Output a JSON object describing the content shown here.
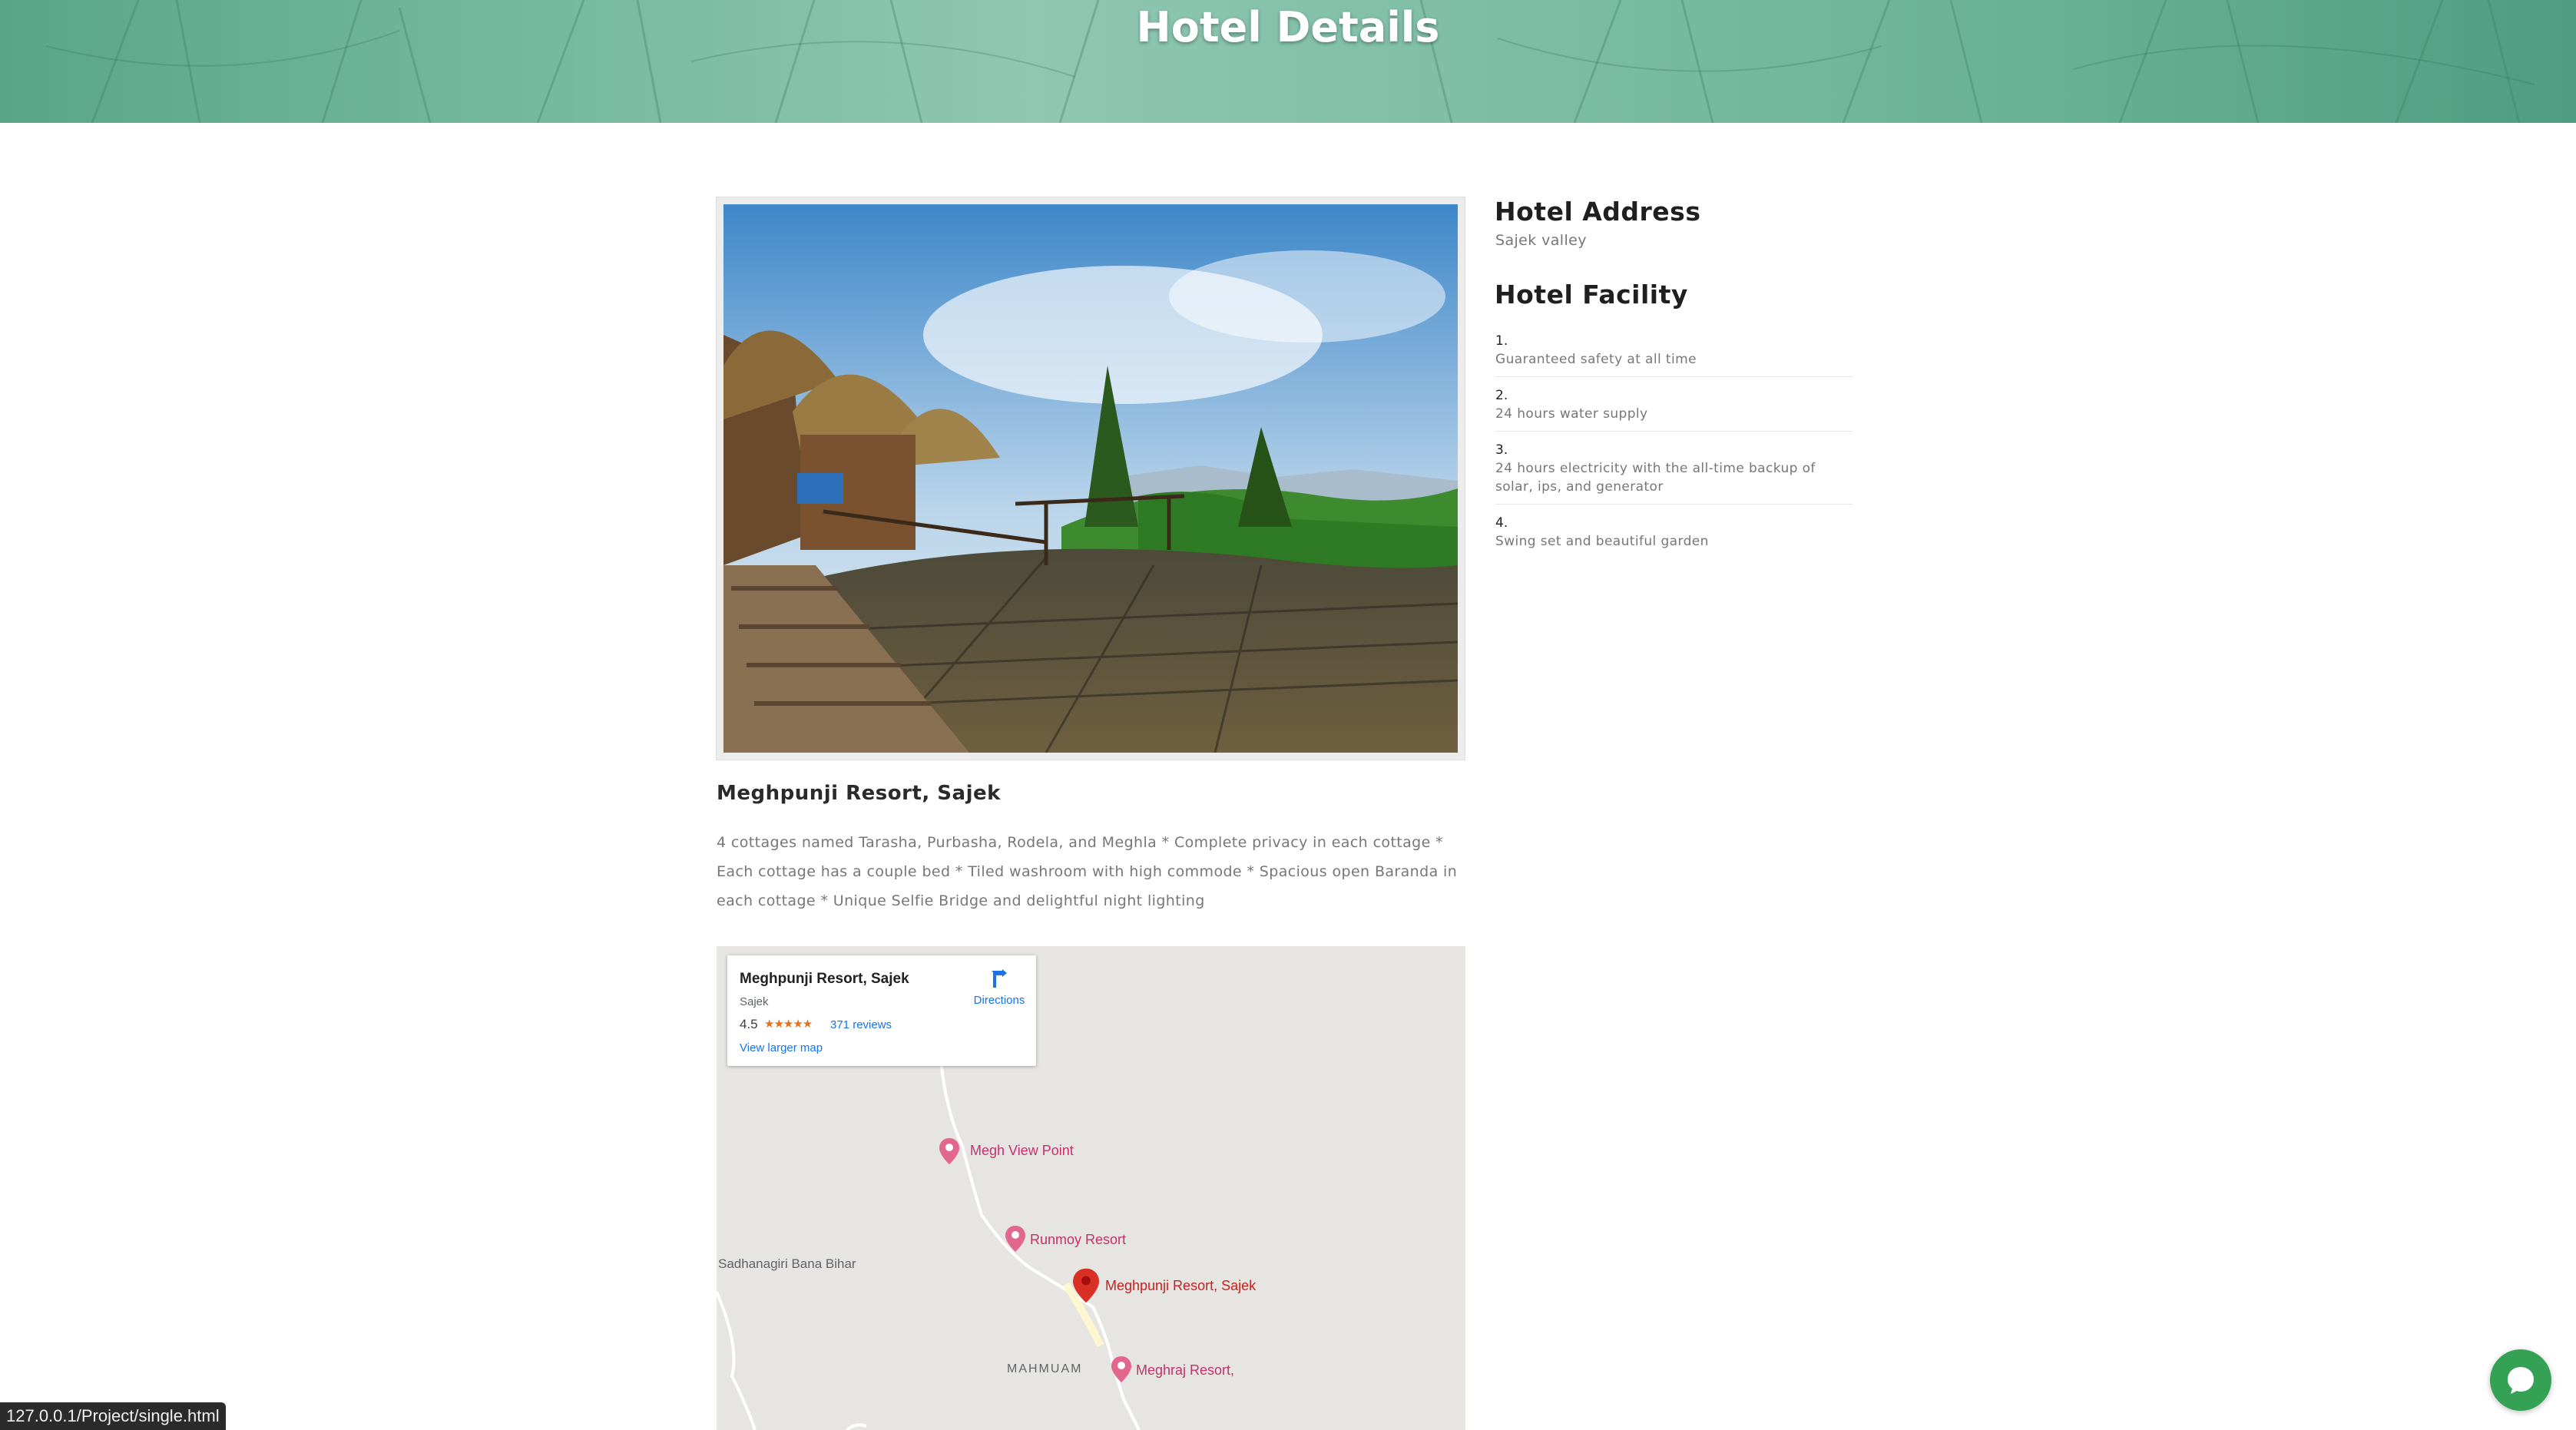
{
  "hero": {
    "title": "Hotel Details"
  },
  "hotel": {
    "photo_alt": "Meghpunji Resort cottages with wooden deck overlooking green hills",
    "name": "Meghpunji Resort, Sajek",
    "description": "4 cottages named Tarasha, Purbasha, Rodela, and Meghla * Complete privacy in each cottage * Each cottage has a couple bed * Tiled washroom with high commode * Spacious open Baranda in each cottage * Unique Selfie Bridge and delightful night lighting"
  },
  "address": {
    "heading": "Hotel Address",
    "value": "Sajek valley"
  },
  "facility": {
    "heading": "Hotel Facility",
    "items": [
      {
        "num": "1.",
        "text": "Guaranteed safety at all time"
      },
      {
        "num": "2.",
        "text": "24 hours water supply"
      },
      {
        "num": "3.",
        "text": "24 hours electricity with the all-time backup of solar, ips, and generator"
      },
      {
        "num": "4.",
        "text": "Swing set and beautiful garden"
      }
    ]
  },
  "map": {
    "card": {
      "title": "Meghpunji Resort, Sajek",
      "subtitle": "Sajek",
      "rating": "4.5",
      "stars": "★★★★★",
      "reviews": "371 reviews",
      "larger_map": "View larger map",
      "directions": "Directions"
    },
    "pois": {
      "megh_view": "Megh View Point",
      "runmoy": "Runmoy Resort",
      "meghpunji": "Meghpunji Resort, Sajek",
      "meghraj": "Meghraj Resort,",
      "sadhanagiri": "Sadhanagiri Bana Bihar",
      "mahmuam": "MAHMUAM"
    }
  },
  "status_bar": {
    "url": "127.0.0.1/Project/single.html"
  },
  "colors": {
    "hero_green": "#6fb59b",
    "chat_green": "#35a155",
    "poi_pink": "#c5306d",
    "link_blue": "#1a73e8"
  }
}
